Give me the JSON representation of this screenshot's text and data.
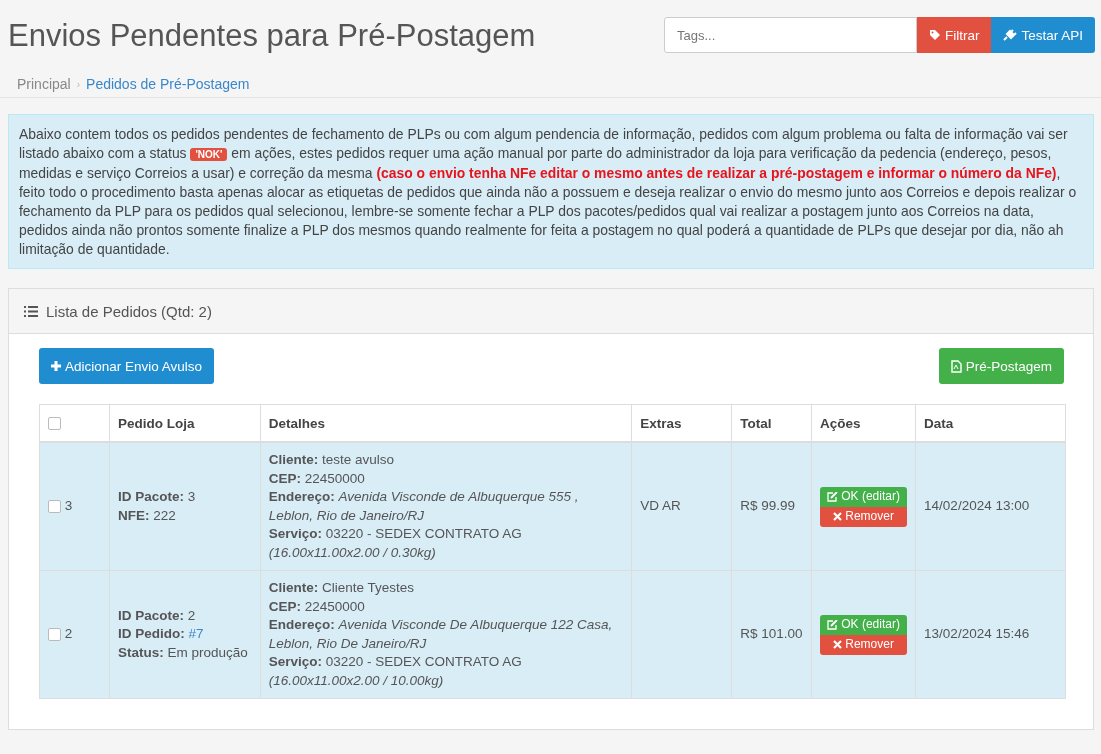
{
  "page_title": "Envios Pendentes para Pré-Postagem",
  "toolbar": {
    "search": {
      "placeholder": "Tags..."
    },
    "buttons": [
      {
        "label": "Filtrar",
        "kind": "danger"
      },
      {
        "label": "Testar API",
        "kind": "primary"
      }
    ]
  },
  "breadcrumb": [
    {
      "label": "Principal",
      "selected": false
    },
    {
      "label": "Pedidos de Pré-Postagem",
      "selected": true
    }
  ],
  "breadcrumb_separator": "›",
  "info": {
    "before": "Abaixo contem todos os pedidos pendentes de fechamento de PLPs ou com algum pendencia de informação, pedidos com algum problema ou falta de informação vai ser listado abaixo com a status",
    "badge": "'NOK'",
    "after": "em ações, estes pedidos requer uma ação manual por parte do administrador da loja para verificação da pedencia (endereço, pesos, medidas e serviço Correios a usar) e correção da mesma **(caso o envio tenha NFe editar o mesmo antes de realizar a pré-postagem e informar o número da NFe)**, feito todo o procedimento basta apenas alocar as etiquetas de pedidos que ainda não a possuem e deseja realizar o envio do mesmo junto aos Correios e depois realizar o fechamento da PLP para os pedidos qual selecionou, lembre-se somente fechar a PLP dos pacotes/pedidos qual vai realizar a postagem junto aos Correios na data, pedidos ainda não prontos somente finalize a PLP dos mesmos quando realmente for feita a postagem no qual poderá a quantidade de PLPs que desejar por dia, não ah limitação de quantidade."
  },
  "panel": {
    "title": "Lista de Pedidos (Qtd: 2)",
    "add_button": "Adicionar Envio Avulso",
    "prepost_button": "Pré-Postagem",
    "table": {
      "header_checked": false,
      "columns": [
        "Pedido Loja",
        "Detalhes",
        "Extras",
        "Total",
        "Ações",
        "Data"
      ],
      "rows": [
        {
          "checked": false,
          "number": "3",
          "order": [
            {
              "label": "ID Pacote:",
              "value": "3",
              "kind": "text"
            },
            {
              "label": "NFE:",
              "value": "222",
              "kind": "text"
            }
          ],
          "details": [
            "**Cliente:** teste avulso",
            "**CEP:** 22450000",
            "**Endereço:** *Avenida Visconde de Albuquerque 555 , Leblon, Rio de Janeiro/RJ*",
            "**Serviço:** 03220 - SEDEX CONTRATO AG *(16.00x11.00x2.00 / 0.30kg)*"
          ],
          "extras": "VD AR",
          "total": "R$ 99.99",
          "ok_label": "OK (editar)",
          "remove_label": "Remover",
          "date": "14/02/2024 13:00"
        },
        {
          "checked": false,
          "number": "2",
          "order": [
            {
              "label": "ID Pacote:",
              "value": "2",
              "kind": "text"
            },
            {
              "label": "ID Pedido:",
              "value": "#7",
              "kind": "link"
            },
            {
              "label": "Status:",
              "value": "Em produção",
              "kind": "text"
            }
          ],
          "details": [
            "**Cliente:** Cliente Tyestes",
            "**CEP:** 22450000",
            "**Endereço:** *Avenida Visconde De Albuquerque 122 Casa, Leblon, Rio De Janeiro/RJ*",
            "**Serviço:** 03220 - SEDEX CONTRATO AG *(16.00x11.00x2.00 / 10.00kg)*"
          ],
          "total": "R$ 101.00",
          "ok_label": "OK (editar)",
          "remove_label": "Remover",
          "date": "13/02/2024 15:46"
        }
      ]
    }
  }
}
